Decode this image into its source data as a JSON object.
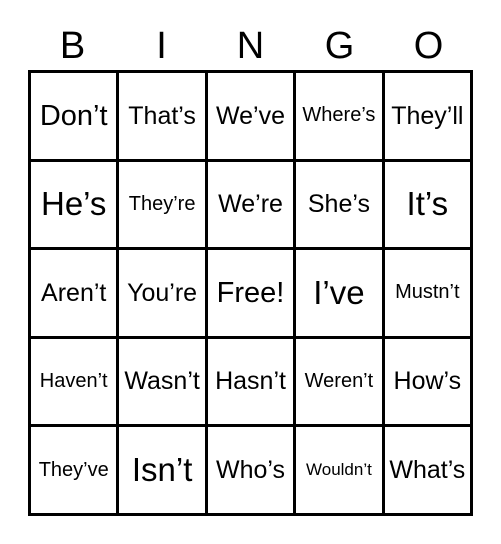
{
  "card": {
    "title_letters": [
      "B",
      "I",
      "N",
      "G",
      "O"
    ],
    "free_space_label": "Free!",
    "colors": {
      "background": "#ffffff",
      "grid_line": "#000000",
      "text": "#000000"
    },
    "rows": [
      [
        {
          "text": "Don’t",
          "size": "lg"
        },
        {
          "text": "That’s",
          "size": "md"
        },
        {
          "text": "We’ve",
          "size": "md"
        },
        {
          "text": "Where’s",
          "size": "sm"
        },
        {
          "text": "They’ll",
          "size": "md"
        }
      ],
      [
        {
          "text": "He’s",
          "size": "xl"
        },
        {
          "text": "They’re",
          "size": "sm"
        },
        {
          "text": "We’re",
          "size": "md"
        },
        {
          "text": "She’s",
          "size": "md"
        },
        {
          "text": "It’s",
          "size": "xl"
        }
      ],
      [
        {
          "text": "Aren’t",
          "size": "md"
        },
        {
          "text": "You’re",
          "size": "md"
        },
        {
          "text": "Free!",
          "size": "lg"
        },
        {
          "text": "I’ve",
          "size": "xl"
        },
        {
          "text": "Mustn’t",
          "size": "sm"
        }
      ],
      [
        {
          "text": "Haven’t",
          "size": "sm"
        },
        {
          "text": "Wasn’t",
          "size": "md"
        },
        {
          "text": "Hasn’t",
          "size": "md"
        },
        {
          "text": "Weren’t",
          "size": "sm"
        },
        {
          "text": "How’s",
          "size": "md"
        }
      ],
      [
        {
          "text": "They’ve",
          "size": "sm"
        },
        {
          "text": "Isn’t",
          "size": "xl"
        },
        {
          "text": "Who’s",
          "size": "md"
        },
        {
          "text": "Wouldn’t",
          "size": "xs"
        },
        {
          "text": "What’s",
          "size": "md"
        }
      ]
    ]
  }
}
